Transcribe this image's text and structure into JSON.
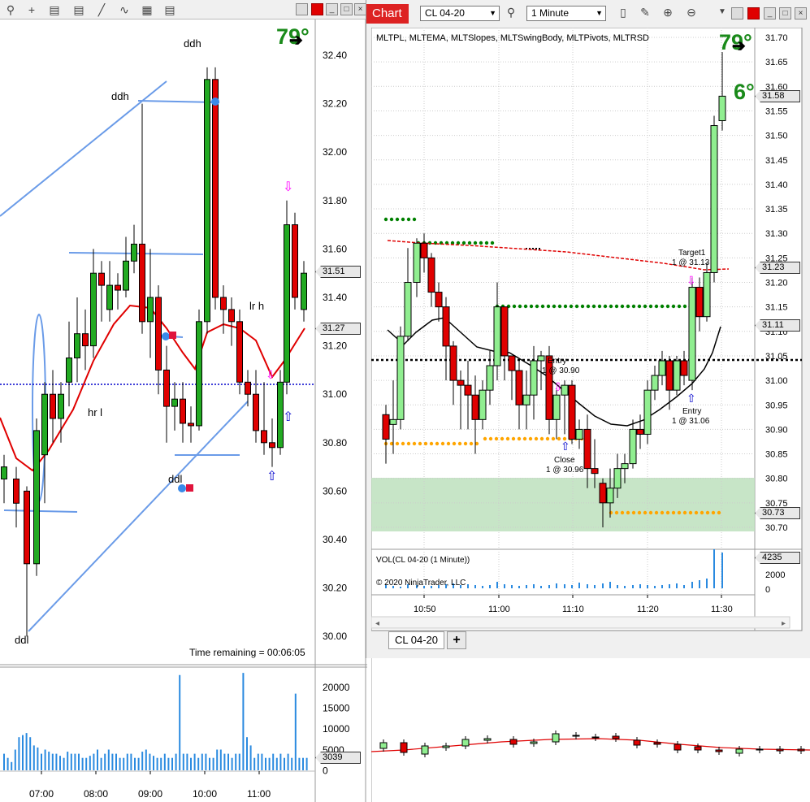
{
  "left_chart": {
    "toolbar_icons": [
      "zoom-icon",
      "crosshair-icon",
      "data-box-icon",
      "properties-icon",
      "line-draw-icon",
      "strategy-icon",
      "bar-spacing-icon"
    ],
    "degree": "79°",
    "price_axis": [
      "32.40",
      "32.20",
      "32.00",
      "31.80",
      "31.60",
      "31.40",
      "31.20",
      "31.00",
      "30.80",
      "30.60",
      "30.40",
      "30.20",
      "30.00"
    ],
    "tag_high": "31.51",
    "tag_low": "31.27",
    "labels": {
      "ddh_top": "ddh",
      "ddh_left": "ddh",
      "hr_l": "hr l",
      "lr_h": "lr h",
      "ddl_mid": "ddl",
      "ddl_bottom": "ddl"
    },
    "time_remaining": "Time remaining = 00:06:05",
    "vol_axis": [
      "20000",
      "15000",
      "10000",
      "5000",
      "0"
    ],
    "vol_tag": "3039",
    "time_axis": [
      "07:00",
      "08:00",
      "09:00",
      "10:00",
      "11:00"
    ]
  },
  "chart_window": {
    "tab_label": "Chart",
    "instrument": "CL 04-20",
    "interval": "1 Minute",
    "indicators": "MLTPL, MLTEMA, MLTSlopes, MLTSwingBody, MLTPivots, MLTRSD",
    "degree_top": "79°",
    "degree_second": "6°",
    "price_axis": [
      "31.70",
      "31.65",
      "31.60",
      "31.55",
      "31.50",
      "31.45",
      "31.40",
      "31.35",
      "31.30",
      "31.25",
      "31.20",
      "31.15",
      "31.10",
      "31.05",
      "31.00",
      "30.95",
      "30.90",
      "30.85",
      "30.80",
      "30.75",
      "30.70"
    ],
    "tag_last": "31.58",
    "tag_a": "31.23",
    "tag_b": "31.11",
    "tag_c": "30.73",
    "vol_label": "VOL(CL 04-20 (1 Minute))",
    "copyright": "© 2020 NinjaTrader, LLC",
    "vol_axis": [
      "2000",
      "0"
    ],
    "vol_tag": "4235",
    "time_axis": [
      "10:50",
      "11:00",
      "11:10",
      "11:20",
      "11:30"
    ],
    "annotations": {
      "entry1_title": "Entry",
      "entry1_detail": "1 @ 30.90",
      "close_title": "Close",
      "close_detail": "1 @ 30.96",
      "target_title": "Target1",
      "target_detail": "1 @ 31.13",
      "entry2_title": "Entry",
      "entry2_detail": "1 @ 31.06"
    },
    "bottom_tab": "CL 04-20",
    "add_tab": "+"
  },
  "colors": {
    "up": "#90ee90",
    "down": "#e00000",
    "line_blue": "#6a9be8",
    "ema_red": "#e00000",
    "pivot_green": "#008000",
    "pivot_orange": "#ffa500",
    "degree_green": "#1a8a1a",
    "vol_blue": "#2a8ae0"
  }
}
